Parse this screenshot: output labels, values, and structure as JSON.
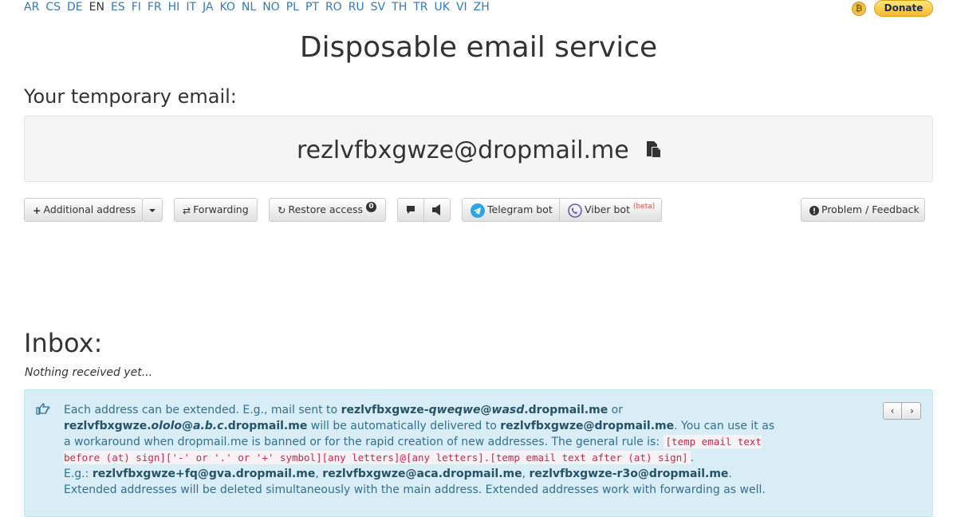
{
  "languages": [
    "AR",
    "CS",
    "DE",
    "EN",
    "ES",
    "FI",
    "FR",
    "HI",
    "IT",
    "JA",
    "KO",
    "NL",
    "NO",
    "PL",
    "PT",
    "RO",
    "RU",
    "SV",
    "TH",
    "TR",
    "UK",
    "VI",
    "ZH"
  ],
  "current_language": "EN",
  "donate_label": "Donate",
  "page_title": "Disposable email service",
  "email_label": "Your temporary email:",
  "email_address": "rezlvfbxgwze@dropmail.me",
  "toolbar": {
    "additional_address": "Additional address",
    "forwarding": "Forwarding",
    "restore_access": "Restore access",
    "restore_badge": "0",
    "telegram_bot": "Telegram bot",
    "viber_bot": "Viber bot",
    "viber_beta": "(beta)",
    "problem_feedback": "Problem / Feedback"
  },
  "inbox": {
    "title": "Inbox:",
    "empty_text": "Nothing received yet..."
  },
  "info": {
    "t1": "Each address can be extended. E.g., mail sent to ",
    "ex1_a": "rezlvfbxgwze-",
    "ex1_b": "qweqwe",
    "ex1_c": "@",
    "ex1_d": "wasd",
    "ex1_e": ".dropmail.me",
    "t2": " or ",
    "ex2_a": "rezlvfbxgwze.",
    "ex2_b": "ololo",
    "ex2_c": "@",
    "ex2_d": "a.b.c",
    "ex2_e": ".dropmail.me",
    "t3": " will be automatically delivered to ",
    "main_addr": "rezlvfbxgwze@dropmail.me",
    "t4": ". You can use it as a workaround when dropmail.me is banned or for the rapid creation of new addresses. The general rule is: ",
    "rule": "[temp email text before (at) sign]['-' or '.' or '+' symbol][any letters]@[any letters].[temp email text after (at) sign]",
    "t5": ".",
    "t6": "E.g.: ",
    "eg1": "rezlvfbxgwze+fq@gva.dropmail.me",
    "sep1": ", ",
    "eg2": "rezlvfbxgwze@aca.dropmail.me",
    "sep2": ", ",
    "eg3": "rezlvfbxgwze-r3o@dropmail.me",
    "t7": ".",
    "t8": "Extended addresses will be deleted simultaneously with the main address. Extended addresses work with forwarding as well.",
    "prev": "‹",
    "next": "›"
  },
  "colors": {
    "link": "#337ab7",
    "info_bg": "#d9edf7",
    "info_text": "#31708f",
    "code": "#c7254e"
  }
}
